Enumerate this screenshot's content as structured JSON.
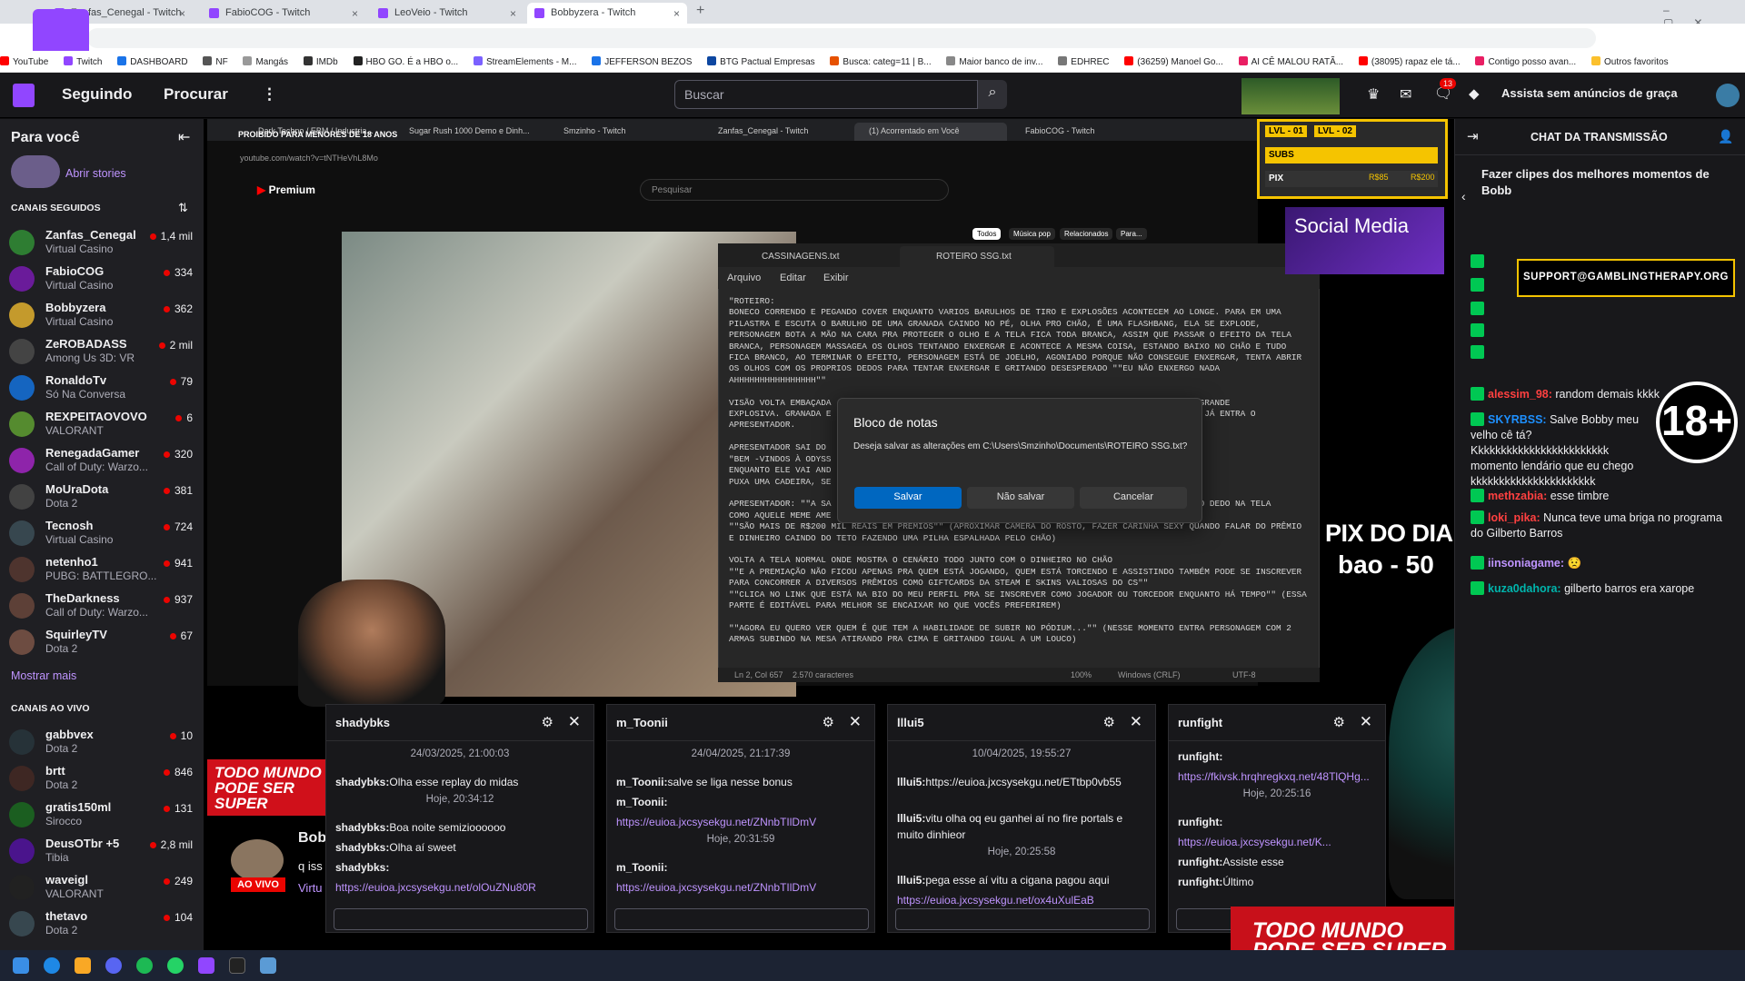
{
  "browser": {
    "tabs": [
      {
        "label": "Zanfas_Cenegal - Twitch"
      },
      {
        "label": "FabioCOG - Twitch"
      },
      {
        "label": "LeoVeio - Twitch"
      },
      {
        "label": "Bobbyzera - Twitch"
      }
    ],
    "bookmarks": [
      "YouTube",
      "Twitch",
      "DASHBOARD",
      "NF",
      "Mangás",
      "IMDb",
      "HBO GO. É a HBO o...",
      "StreamElements - M...",
      "JEFFERSON BEZOS",
      "BTG Pactual Empresas",
      "Busca: categ=11 | B...",
      "Maior banco de inv...",
      "EDHREC",
      "(36259) Manoel Go...",
      "AI CÊ MALOU RATÃ...",
      "(38095) rapaz ele tá...",
      "Contigo posso avan...",
      "Outros favoritos"
    ]
  },
  "twitch": {
    "nav": {
      "following": "Seguindo",
      "browse": "Procurar",
      "search_placeholder": "Buscar",
      "ad_free": "Assista sem anúncios de graça",
      "notif_count": "13"
    },
    "sidebar": {
      "title": "Para você",
      "stories": "Abrir stories",
      "followed_header": "CANAIS SEGUIDOS",
      "followed": [
        {
          "name": "Zanfas_Cenegal",
          "game": "Virtual Casino",
          "viewers": "1,4 mil",
          "color": "#2e7d32"
        },
        {
          "name": "FabioCOG",
          "game": "Virtual Casino",
          "viewers": "334",
          "color": "#6a1b9a"
        },
        {
          "name": "Bobbyzera",
          "game": "Virtual Casino",
          "viewers": "362",
          "color": "#c49a2c"
        },
        {
          "name": "ZeROBADASS",
          "game": "Among Us 3D: VR",
          "viewers": "2 mil",
          "color": "#444"
        },
        {
          "name": "RonaldoTv",
          "game": "Só Na Conversa",
          "viewers": "79",
          "color": "#1565c0"
        },
        {
          "name": "REXPEITAOVOVO",
          "game": "VALORANT",
          "viewers": "6",
          "color": "#558b2f"
        },
        {
          "name": "RenegadaGamer",
          "game": "Call of Duty: Warzo...",
          "viewers": "320",
          "color": "#8e24aa"
        },
        {
          "name": "MoUraDota",
          "game": "Dota 2",
          "viewers": "381",
          "color": "#424242"
        },
        {
          "name": "Tecnosh",
          "game": "Virtual Casino",
          "viewers": "724",
          "color": "#37474f"
        },
        {
          "name": "netenho1",
          "game": "PUBG: BATTLEGRO...",
          "viewers": "941",
          "color": "#4e342e"
        },
        {
          "name": "TheDarkness",
          "game": "Call of Duty: Warzo...",
          "viewers": "937",
          "color": "#5d4037"
        },
        {
          "name": "SquirleyTV",
          "game": "Dota 2",
          "viewers": "67",
          "color": "#6d4c41"
        }
      ],
      "show_more": "Mostrar mais",
      "live_header": "CANAIS AO VIVO",
      "live": [
        {
          "name": "gabbvex",
          "game": "Dota 2",
          "viewers": "10",
          "color": "#263238"
        },
        {
          "name": "brtt",
          "game": "Dota 2",
          "viewers": "846",
          "color": "#3e2723"
        },
        {
          "name": "gratis150ml",
          "game": "Sirocco",
          "viewers": "131",
          "color": "#1b5e20"
        },
        {
          "name": "DeusOTbr +5",
          "game": "Tibia",
          "viewers": "2,8 mil",
          "color": "#4a148c"
        },
        {
          "name": "waveigl",
          "game": "VALORANT",
          "viewers": "249",
          "color": "#212121"
        },
        {
          "name": "thetavo",
          "game": "Dota 2",
          "viewers": "104",
          "color": "#37474f"
        }
      ]
    }
  },
  "stream": {
    "inner_tabs": [
      "Dark Techno / EBM / Industria...",
      "Sugar Rush 1000 Demo e Dinh...",
      "Smzinho - Twitch",
      "Zanfas_Cenegal - Twitch",
      "(1) Acorrentado em Você",
      "FabioCOG - Twitch"
    ],
    "inner_url": "youtube.com/watch?v=tNTHeVhL8Mo",
    "yt_search": "Pesquisar",
    "yt_logo": "Premium",
    "yt_chips": [
      "Todos",
      "Música pop",
      "Relacionados",
      "Para..."
    ],
    "overlay_warning": "PROIBIDO PARA MENORES DE 18 ANOS",
    "notepad": {
      "tabs": [
        "CASSINAGENS.txt",
        "ROTEIRO SSG.txt"
      ],
      "menu": [
        "Arquivo",
        "Editar",
        "Exibir"
      ],
      "text": "\"ROTEIRO:\nBONECO CORRENDO E PEGANDO COVER ENQUANTO VARIOS BARULHOS DE TIRO E EXPLOSÕES ACONTECEM AO LONGE. PARA EM UMA PILASTRA E ESCUTA O BARULHO DE UMA GRANADA CAINDO NO PÉ, OLHA PRO CHÃO, É UMA FLASHBANG, ELA SE EXPLODE, PERSONAGEM BOTA A MÃO NA CARA PRA PROTEGER O OLHO E A TELA FICA TODA BRANCA, ASSIM QUE PASSAR O EFEITO DA TELA BRANCA, PERSONAGEM MASSAGEA OS OLHOS TENTANDO ENXERGAR E ACONTECE A MESMA COISA, ESTANDO BAIXO NO CHÃO E TUDO FICA BRANCO, AO TERMINAR O EFEITO, PERSONAGEM ESTÁ DE JOELHO, AGONIADO PORQUE NÃO CONSEGUE ENXERGAR, TENTA ABRIR OS OLHOS COM OS PROPRIOS DEDOS PARA TENTAR ENXERGAR E GRITANDO DESESPERADO \"\"EU NÃO ENXERGO NADA AHHHHHHHHHHHHHHHH\"\"\n\nVISÃO VOLTA EMBAÇADA                                                                    UMA GRANDE\nEXPLOSIVA. GRANADA E                                                                   USA E JÁ ENTRA O\nAPRESENTADOR.\n\nAPRESENTADOR SAI DO\n\"BEM -VINDOS À ODYSS\nENQUANTO ELE VAI AND                                                                   IO.\nPUXA UMA CADEIRA, SE\n\nAPRESENTADOR: \"\"A SA                                                                   ONTO O DEDO NA TELA\nCOMO AQUELE MEME AME\n\"\"SÃO MAIS DE R$200 MIL REAIS EM PRÊMIOS\"\" (APROXIMAR CAMERA DO ROSTO, FAZER CARINHA SEXY QUANDO FALAR DO PRÊMIO E DINHEIRO CAINDO DO TETO FAZENDO UMA PILHA ESPALHADA PELO CHÃO)\n\nVOLTA A TELA NORMAL ONDE MOSTRA O CENÁRIO TODO JUNTO COM O DINHEIRO NO CHÃO\n\"\"E A PREMIAÇÃO NÃO FICOU APENAS PRA QUEM ESTÁ JOGANDO, QUEM ESTÁ TORCENDO E ASSISTINDO TAMBÉM PODE SE INSCREVER PARA CONCORRER A DIVERSOS PRÊMIOS COMO GIFTCARDS DA STEAM E SKINS VALIOSAS DO CS\"\"\n\"\"CLICA NO LINK QUE ESTÁ NA BIO DO MEU PERFIL PRA SE INSCREVER COMO JOGADOR OU TORCEDOR ENQUANTO HÁ TEMPO\"\" (ESSA PARTE É EDITÁVEL PARA MELHOR SE ENCAIXAR NO QUE VOCÊS PREFERIREM)\n\n\"\"AGORA EU QUERO VER QUEM É QUE TEM A HABILIDADE DE SUBIR NO PÓDIUM...\"\" (NESSE MOMENTO ENTRA PERSONAGEM COM 2 ARMAS SUBINDO NA MESA ATIRANDO PRA CIMA E GRITANDO IGUAL A UM LOUCO)",
      "status": [
        "Ln 2, Col 657",
        "2.570 caracteres",
        "100%",
        "Windows (CRLF)",
        "UTF-8"
      ]
    },
    "dialog": {
      "title": "Bloco de notas",
      "message": "Deseja salvar as alterações em C:\\Users\\Smzinho\\Documents\\ROTEIRO SSG.txt?",
      "save": "Salvar",
      "dont_save": "Não salvar",
      "cancel": "Cancelar"
    },
    "overlays": {
      "lvl": [
        "LVL - 01",
        "LVL - 02"
      ],
      "subs": "SUBS",
      "pix": "PIX",
      "pix_values": [
        "R$85",
        "R$200"
      ],
      "social": "Social Media",
      "pix_dia": "PIX DO DIA",
      "pix_dia_value": "bao - 50",
      "todo_mundo": "TODO MUNDO PODE SER SUPER",
      "ao_vivo": "AO VIVO",
      "plus18": "18+"
    },
    "chats": [
      {
        "name": "shadybks",
        "lines": [
          {
            "t": "date",
            "v": "24/03/2025, 21:00:03"
          },
          {
            "t": "msg",
            "u": "shadybks:",
            "v": "Olha esse replay do midas"
          },
          {
            "t": "date",
            "v": "Hoje, 20:34:12"
          },
          {
            "t": "msg",
            "u": "shadybks:",
            "v": "Boa noite semizioooooo"
          },
          {
            "t": "msg",
            "u": "shadybks:",
            "v": "Olha aí sweet"
          },
          {
            "t": "msg",
            "u": "shadybks:",
            "v": ""
          },
          {
            "t": "link",
            "v": "https://euioa.jxcsysekgu.net/olOuZNu80R"
          }
        ]
      },
      {
        "name": "m_Toonii",
        "lines": [
          {
            "t": "date",
            "v": "24/04/2025, 21:17:39"
          },
          {
            "t": "msg",
            "u": "m_Toonii:",
            "v": "salve se liga nesse bonus"
          },
          {
            "t": "msg",
            "u": "m_Toonii:",
            "v": ""
          },
          {
            "t": "link",
            "v": "https://euioa.jxcsysekgu.net/ZNnbTIlDmV"
          },
          {
            "t": "date",
            "v": "Hoje, 20:31:59"
          },
          {
            "t": "msg",
            "u": "m_Toonii:",
            "v": ""
          },
          {
            "t": "link",
            "v": "https://euioa.jxcsysekgu.net/ZNnbTIlDmV"
          }
        ]
      },
      {
        "name": "lllui5",
        "lines": [
          {
            "t": "date",
            "v": "10/04/2025, 19:55:27"
          },
          {
            "t": "msg",
            "u": "lllui5:",
            "v": "https://euioa.jxcsysekgu.net/ETtbp0vb55"
          },
          {
            "t": "msg",
            "u": "lllui5:",
            "v": "vitu olha oq eu ganhei aí no fire portals e muito dinhieor"
          },
          {
            "t": "date",
            "v": "Hoje, 20:25:58"
          },
          {
            "t": "msg",
            "u": "lllui5:",
            "v": "pega esse aí vitu a cigana pagou aqui"
          },
          {
            "t": "link",
            "v": "https://euioa.jxcsysekgu.net/ox4uXulEaB"
          }
        ]
      },
      {
        "name": "runfight",
        "lines": [
          {
            "t": "msg",
            "u": "runfight:",
            "v": ""
          },
          {
            "t": "link",
            "v": "https://fkivsk.hrqhregkxq.net/48TlQHg..."
          },
          {
            "t": "date",
            "v": "Hoje, 20:25:16"
          },
          {
            "t": "msg",
            "u": "runfight:",
            "v": ""
          },
          {
            "t": "link",
            "v": "https://euioa.jxcsysekgu.net/K..."
          },
          {
            "t": "msg",
            "u": "runfight:",
            "v": "Assiste esse"
          },
          {
            "t": "msg",
            "u": "runfight:",
            "v": "Último"
          }
        ]
      }
    ],
    "streamer_name": "Bob",
    "streamer_sub": "q iss",
    "streamer_cat": "Virtu"
  },
  "right_chat": {
    "header": "CHAT DA TRANSMISSÃO",
    "pinned": "Fazer clipes dos melhores momentos de Bobb",
    "support": "SUPPORT@GAMBLINGTHERAPY.ORG",
    "messages": [
      {
        "u": "alessim_98:",
        "v": "random demais kkkk",
        "c": "#ff4040"
      },
      {
        "u": "SKYRBSS:",
        "v": "Salve Bobby meu velho cê tá? Kkkkkkkkkkkkkkkkkkkkkkkk momento lendário que eu chego kkkkkkkkkkkkkkkkkkkkkk",
        "c": "#1e90ff"
      },
      {
        "u": "methzabia:",
        "v": "esse timbre",
        "c": "#ff4040"
      },
      {
        "u": "loki_pika:",
        "v": "Nunca teve uma briga no programa do Gilberto Barros",
        "c": "#ff4040"
      },
      {
        "u": "iinsoniagame:",
        "v": "😟",
        "c": "#bf94ff"
      },
      {
        "u": "kuza0dahora:",
        "v": "gilberto barros era xarope",
        "c": "#00b5ad"
      }
    ]
  }
}
